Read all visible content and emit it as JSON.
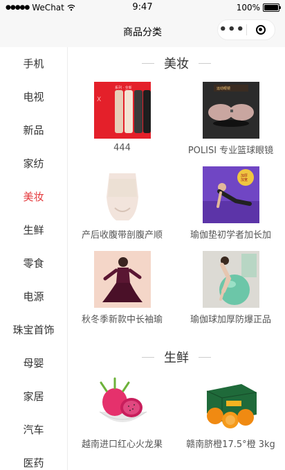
{
  "status_bar": {
    "carrier": "WeChat",
    "time": "9:47",
    "battery": "100%"
  },
  "nav": {
    "title": "商品分类"
  },
  "sidebar": {
    "items": [
      {
        "label": "手机"
      },
      {
        "label": "电视"
      },
      {
        "label": "新品"
      },
      {
        "label": "家纺"
      },
      {
        "label": "美妆",
        "active": true
      },
      {
        "label": "生鲜"
      },
      {
        "label": "零食"
      },
      {
        "label": "电源"
      },
      {
        "label": "珠宝首饰"
      },
      {
        "label": "母婴"
      },
      {
        "label": "家居"
      },
      {
        "label": "汽车"
      },
      {
        "label": "医药"
      }
    ]
  },
  "sections": [
    {
      "title": "美妆",
      "products": [
        {
          "name": "444",
          "thumb": "phones-icon"
        },
        {
          "name": "POLISI 专业篮球眼镜",
          "thumb": "sunglasses-icon"
        },
        {
          "name": "产后收腹带剖腹产顺",
          "thumb": "body-shaper-icon"
        },
        {
          "name": "瑜伽垫初学者加长加",
          "thumb": "yoga-mat-icon"
        },
        {
          "name": "秋冬季新款中长袖瑜",
          "thumb": "yoga-wear-icon"
        },
        {
          "name": "瑜伽球加厚防爆正品",
          "thumb": "yoga-ball-icon"
        }
      ]
    },
    {
      "title": "生鲜",
      "products": [
        {
          "name": "越南进口红心火龙果",
          "thumb": "dragon-fruit-icon"
        },
        {
          "name": "赣南脐橙17.5°橙 3kg",
          "thumb": "oranges-icon"
        }
      ]
    }
  ],
  "colors": {
    "active": "#e4393c"
  }
}
